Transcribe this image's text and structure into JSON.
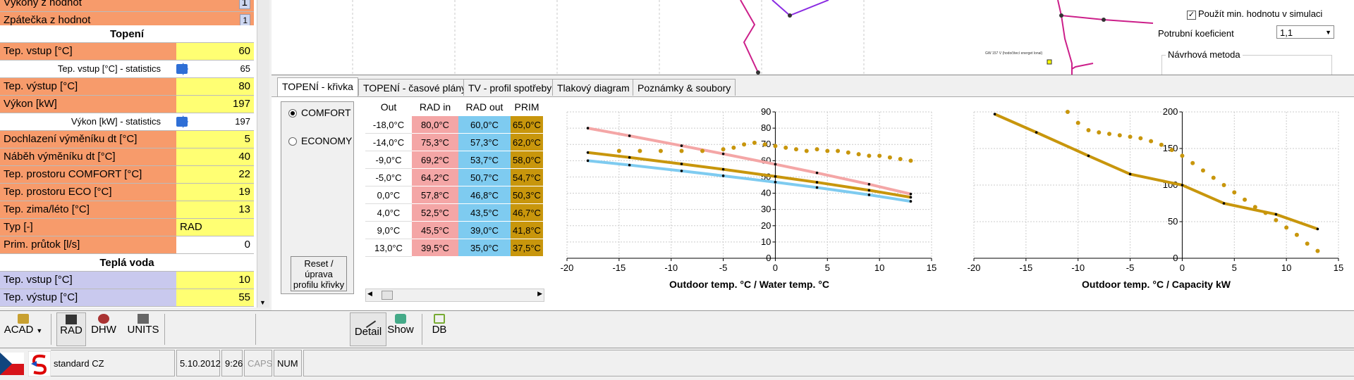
{
  "colors": {
    "orange": "#f79b6b",
    "yellow": "#ffff73",
    "lavender": "#c9c9ee",
    "rad_in": "#f4a6a6",
    "rad_out": "#7ecbf0",
    "prim": "#c8960c",
    "accent_line": "#cc1f8a"
  },
  "left_panel": {
    "top_rows": [
      {
        "label": "Výkony z hodnot",
        "value": "1"
      },
      {
        "label": "Zpátečka z hodnot",
        "value": "1"
      }
    ],
    "section_heating": "Topení",
    "heating_rows": [
      {
        "label": "Tep. vstup [°C]",
        "value": "60"
      },
      {
        "label": "Tep. výstup [°C]",
        "value": "80"
      },
      {
        "label": "Výkon [kW]",
        "value": "197"
      },
      {
        "label": "Dochlazení výměníku dt [°C]",
        "value": "5"
      },
      {
        "label": "Náběh výměníku dt [°C]",
        "value": "40"
      },
      {
        "label": "Tep. prostoru COMFORT [°C]",
        "value": "22"
      },
      {
        "label": "Tep. prostoru ECO [°C]",
        "value": "19"
      },
      {
        "label": "Tep. zima/léto [°C]",
        "value": "13"
      },
      {
        "label": "Typ [-]",
        "value": "RAD"
      },
      {
        "label": "Prim. průtok [l/s]",
        "value": "0"
      }
    ],
    "stats": [
      {
        "label": "Tep. vstup [°C] - statistics",
        "value": "65"
      },
      {
        "label": "Výkon [kW] - statistics",
        "value": "197"
      }
    ],
    "section_hot_water": "Teplá voda",
    "hot_water_rows": [
      {
        "label": "Tep. vstup [°C]",
        "value": "10"
      },
      {
        "label": "Tep. výstup [°C]",
        "value": "55"
      }
    ]
  },
  "drawing": {
    "use_min_label": "Použít min. hodnotu v simulaci",
    "pipe_coef_label": "Potrubní koeficient",
    "pipe_coef_value": "1,1",
    "design_method_label": "Návrhová metoda",
    "tiny_label": "GW 157 V (hodočítecí energet lonal)"
  },
  "tabs": [
    "TOPENÍ - křivka",
    "TOPENÍ - časové plány",
    "TV - profil spotřeby",
    "Tlakový diagram",
    "Poznámky & soubory"
  ],
  "modes": {
    "comfort": "COMFORT",
    "economy": "ECONOMY"
  },
  "reset_button": "Reset / úprava profilu křivky",
  "table": {
    "headers": [
      "Out",
      "RAD in",
      "RAD out",
      "PRIM"
    ],
    "rows": [
      [
        "-18,0°C",
        "80,0°C",
        "60,0°C",
        "65,0°C"
      ],
      [
        "-14,0°C",
        "75,3°C",
        "57,3°C",
        "62,0°C"
      ],
      [
        "-9,0°C",
        "69,2°C",
        "53,7°C",
        "58,0°C"
      ],
      [
        "-5,0°C",
        "64,2°C",
        "50,7°C",
        "54,7°C"
      ],
      [
        "0,0°C",
        "57,8°C",
        "46,8°C",
        "50,3°C"
      ],
      [
        "4,0°C",
        "52,5°C",
        "43,5°C",
        "46,7°C"
      ],
      [
        "9,0°C",
        "45,5°C",
        "39,0°C",
        "41,8°C"
      ],
      [
        "13,0°C",
        "39,5°C",
        "35,0°C",
        "37,5°C"
      ]
    ]
  },
  "chart_data": [
    {
      "type": "line",
      "xlabel": "Outdoor temp. °C / Water temp. °C",
      "xlim": [
        -20,
        15
      ],
      "ylim": [
        0,
        90
      ],
      "xticks": [
        -20,
        -15,
        -10,
        -5,
        0,
        5,
        10,
        15
      ],
      "yticks": [
        0,
        10,
        20,
        30,
        40,
        50,
        60,
        70,
        80,
        90
      ],
      "grid": true,
      "series": [
        {
          "style": "line",
          "color": "#f4a6a6",
          "x": [
            -18,
            -14,
            -9,
            -5,
            0,
            4,
            9,
            13
          ],
          "y": [
            80,
            75.3,
            69.2,
            64.2,
            57.8,
            52.5,
            45.5,
            39.5
          ]
        },
        {
          "style": "line",
          "color": "#7ecbf0",
          "x": [
            -18,
            -14,
            -9,
            -5,
            0,
            4,
            9,
            13
          ],
          "y": [
            60,
            57.3,
            53.7,
            50.7,
            46.8,
            43.5,
            39,
            35
          ]
        },
        {
          "style": "line",
          "color": "#c8960c",
          "x": [
            -18,
            -14,
            -9,
            -5,
            0,
            4,
            9,
            13
          ],
          "y": [
            65,
            62,
            58,
            54.7,
            50.3,
            46.7,
            41.8,
            37.5
          ]
        },
        {
          "style": "dots",
          "color": "#c8960c",
          "x": [
            -15,
            -13,
            -11,
            -9,
            -7,
            -5,
            -4,
            -3,
            -2,
            -1,
            0,
            1,
            2,
            3,
            4,
            5,
            6,
            7,
            8,
            9,
            10,
            11,
            12,
            13
          ],
          "y": [
            66,
            66,
            66,
            66,
            66,
            67,
            68,
            70,
            71,
            70,
            69,
            68,
            67,
            66,
            67,
            66,
            66,
            65,
            64,
            63,
            63,
            62,
            61,
            60
          ]
        }
      ]
    },
    {
      "type": "line",
      "xlabel": "Outdoor temp. °C / Capacity kW",
      "xlim": [
        -20,
        15
      ],
      "ylim": [
        0,
        200
      ],
      "xticks": [
        -20,
        -15,
        -10,
        -5,
        0,
        5,
        10,
        15
      ],
      "yticks": [
        0,
        50,
        100,
        150,
        200
      ],
      "grid": true,
      "series": [
        {
          "style": "line",
          "color": "#c8960c",
          "x": [
            -18,
            -14,
            -9,
            -5,
            0,
            4,
            9,
            13
          ],
          "y": [
            197,
            172,
            140,
            115,
            100,
            75,
            60,
            40
          ]
        },
        {
          "style": "dots",
          "color": "#c8960c",
          "x": [
            -11,
            -10,
            -9,
            -8,
            -7,
            -6,
            -5,
            -4,
            -3,
            -2,
            -1,
            0,
            1,
            2,
            3,
            4,
            5,
            6,
            7,
            8,
            9,
            10,
            11,
            12,
            13
          ],
          "y": [
            200,
            185,
            175,
            172,
            170,
            168,
            166,
            164,
            160,
            155,
            148,
            140,
            130,
            120,
            110,
            100,
            90,
            80,
            70,
            62,
            52,
            42,
            32,
            20,
            10
          ]
        }
      ]
    }
  ],
  "toolbar": {
    "acad": "ACAD",
    "rad": "RAD",
    "dhw": "DHW",
    "units": "UNITS",
    "detail": "Detail",
    "show": "Show",
    "db": "DB"
  },
  "status": {
    "profile": "standard CZ",
    "date": "5.10.2012",
    "time": "9:26",
    "caps": "CAPS",
    "num": "NUM"
  }
}
